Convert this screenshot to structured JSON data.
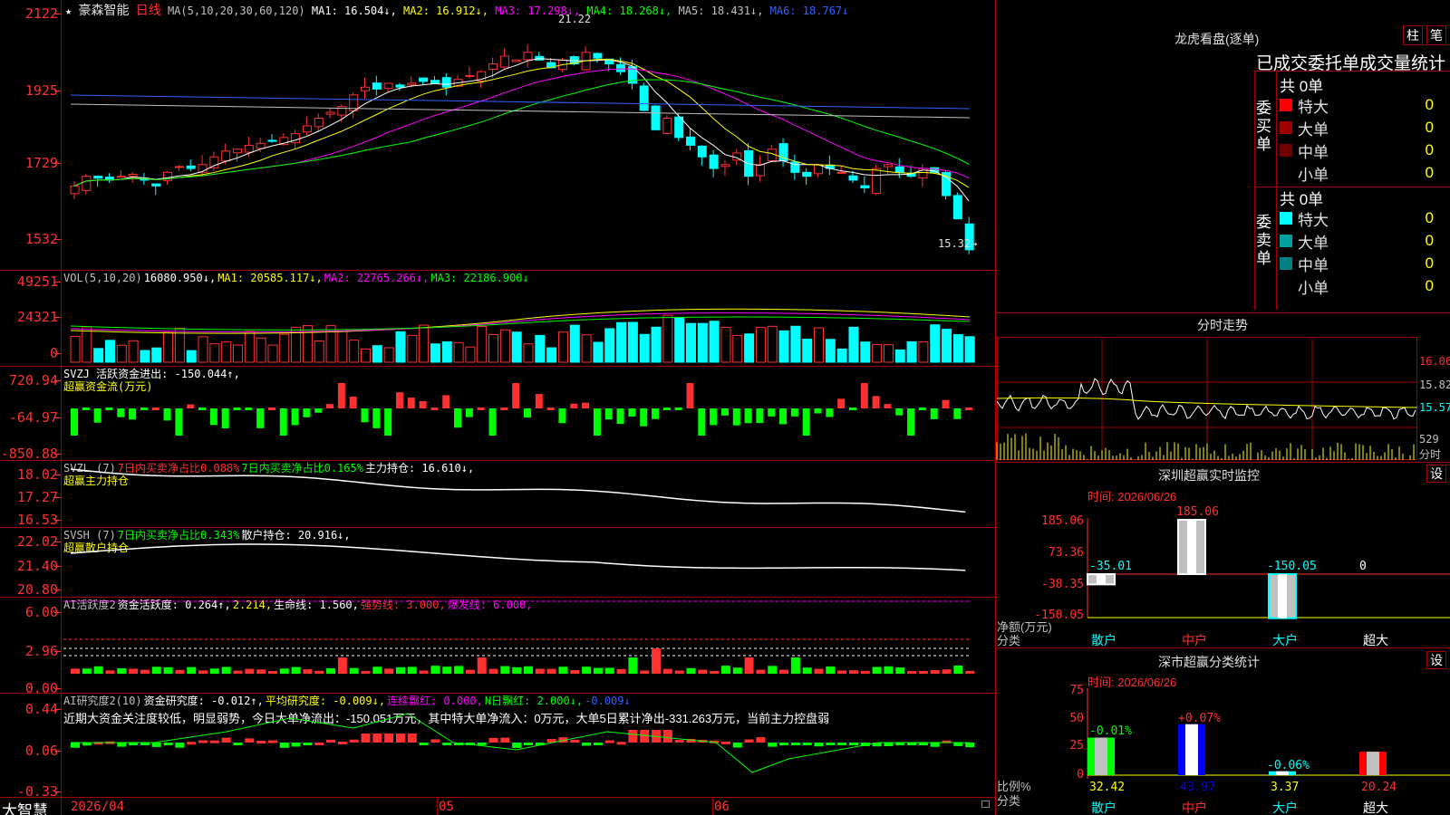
{
  "header": {
    "star": "★",
    "stock_name": "豪森智能",
    "period": "日线",
    "ma_params": "MA(5,10,20,30,60,120)",
    "ma_values": [
      {
        "label": "MA1: 16.504↓,",
        "color": "#ffffff"
      },
      {
        "label": "MA2: 16.912↓,",
        "color": "#ffff00"
      },
      {
        "label": "MA3: 17.298↓,",
        "color": "#ff00ff"
      },
      {
        "label": "MA4: 18.268↓,",
        "color": "#00ff00"
      },
      {
        "label": "MA5: 18.431↓,",
        "color": "#c0c0c0"
      },
      {
        "label": "MA6: 18.767↓",
        "color": "#3060ff"
      }
    ],
    "high_label": "21.22",
    "low_label": "15.32→"
  },
  "price_axis": [
    "2122",
    "1925",
    "1729",
    "1532"
  ],
  "vol_panel": {
    "items": [
      {
        "label": "VOL(5,10,20)",
        "color": "#c0c0c0"
      },
      {
        "label": "16080.950↓,",
        "color": "#ffffff"
      },
      {
        "label": "MA1: 20585.117↓,",
        "color": "#ffff00"
      },
      {
        "label": "MA2: 22765.266↓,",
        "color": "#ff00ff"
      },
      {
        "label": "MA3: 22186.900↓",
        "color": "#00ff00"
      }
    ],
    "axis": [
      "49251",
      "24321",
      "0"
    ]
  },
  "svzj_panel": {
    "items": [
      {
        "label": "SVZJ  活跃资金进出: -150.044↑,",
        "color": "#ffffff"
      }
    ],
    "line2": "超赢资金流(万元)",
    "axis": [
      "720.94",
      "-64.97",
      "-850.88"
    ]
  },
  "svzl_panel": {
    "items": [
      {
        "label": "SVZL (7)",
        "color": "#c0c0c0"
      },
      {
        "label": "7日内买卖净占比0.088%",
        "color": "#ff3030"
      },
      {
        "label": "7日内买卖净占比0.165%",
        "color": "#00ff00"
      },
      {
        "label": "主力持仓: 16.610↓,",
        "color": "#ffffff"
      }
    ],
    "line2": "超赢主力持仓",
    "axis": [
      "18.02",
      "17.27",
      "16.53"
    ]
  },
  "svsh_panel": {
    "items": [
      {
        "label": "SVSH (7)",
        "color": "#c0c0c0"
      },
      {
        "label": "7日内买卖净占比0.343%",
        "color": "#00ff00"
      },
      {
        "label": "散户持仓: 20.916↓,",
        "color": "#ffffff"
      }
    ],
    "line2": "超赢散户持仓",
    "axis": [
      "22.02",
      "21.40",
      "20.80"
    ]
  },
  "ai_activity_panel": {
    "items": [
      {
        "label": "AI活跃度2",
        "color": "#c0c0c0"
      },
      {
        "label": "资金活跃度: 0.264↑,",
        "color": "#ffffff"
      },
      {
        "label": "2.214,",
        "color": "#ffff00"
      },
      {
        "label": "生命线: 1.560,",
        "color": "#ffffff"
      },
      {
        "label": "强势线: 3.000,",
        "color": "#ff3030"
      },
      {
        "label": "爆发线: 6.000,",
        "color": "#ff00ff"
      }
    ],
    "axis": [
      "6.00",
      "2.96",
      "0.00"
    ]
  },
  "ai_research_panel": {
    "items": [
      {
        "label": "AI研究度2(10)",
        "color": "#c0c0c0"
      },
      {
        "label": "资金研究度: -0.012↑,",
        "color": "#ffffff"
      },
      {
        "label": "平均研究度: -0.009↓,",
        "color": "#ffff00"
      },
      {
        "label": "连续飘红: 0.000,",
        "color": "#ff00ff"
      },
      {
        "label": "N日飘红: 2.000↓,",
        "color": "#00ff00"
      },
      {
        "label": "-0.009↓",
        "color": "#3060ff"
      }
    ],
    "note": "近期大资金关注度较低，明显弱势，今日大单净流出：-150.051万元，其中特大单净流入：0万元，大单5日累计净出-331.263万元，当前主力控盘弱",
    "axis": [
      "0.44",
      "0.06",
      "-0.33"
    ]
  },
  "bottom_bar": {
    "brand": "大智慧",
    "dates": [
      "2026/04",
      "05",
      "06"
    ]
  },
  "right_panel": {
    "dragon_title": "龙虎看盘(逐单)",
    "btn_column": "柱",
    "btn_brush": "笔",
    "tabs_line": "已成交委托单成交量统计",
    "buy_side": {
      "side_label": "委买单",
      "total": "共 0单",
      "rows": [
        {
          "label": "特大",
          "count": "0",
          "pct": "0%",
          "color": "#ff0000"
        },
        {
          "label": "大单",
          "count": "0",
          "pct": "0%",
          "color": "#a00000"
        },
        {
          "label": "中单",
          "count": "0",
          "pct": "0%",
          "color": "#700000"
        },
        {
          "label": "小单",
          "count": "0",
          "pct": "0%",
          "color": "#000000"
        }
      ]
    },
    "sell_side": {
      "side_label": "委卖单",
      "total": "共 0单",
      "rows": [
        {
          "label": "特大",
          "count": "0",
          "pct": "0%",
          "color": "#00ffff"
        },
        {
          "label": "大单",
          "count": "0",
          "pct": "0%",
          "color": "#00a0a0"
        },
        {
          "label": "中单",
          "count": "0",
          "pct": "0%",
          "color": "#008080"
        },
        {
          "label": "小单",
          "count": "0",
          "pct": "0%",
          "color": "#000000"
        }
      ]
    },
    "intraday": {
      "title": "分时走势",
      "axis": [
        "16.06",
        "15.82",
        "15.57"
      ],
      "vol_label": "529",
      "vol_unit": "分时"
    },
    "monitor": {
      "title": "深圳超赢实时监控",
      "settings": "设",
      "time": "时间: 2026/06/26",
      "ylabel": "净额(万元)",
      "xlabel": "分类",
      "axis": [
        "185.06",
        "73.36",
        "-38.35",
        "-150.05"
      ],
      "categories": [
        "散户",
        "中户",
        "大户",
        "超大"
      ],
      "values": [
        "-35.01",
        "185.06",
        "-150.05",
        "0"
      ]
    },
    "stats": {
      "title": "深市超赢分类统计",
      "settings": "设",
      "time": "时间: 2026/06/26",
      "ylabel": "比例%",
      "xlabel": "分类",
      "axis": [
        "75",
        "50",
        "25",
        "0"
      ],
      "categories": [
        "散户",
        "中户",
        "大户",
        "超大"
      ],
      "values": [
        "32.42",
        "43.97",
        "3.37",
        "20.24"
      ],
      "changes": [
        "-0.01%",
        "+0.07%",
        "-0.06%",
        ""
      ]
    }
  }
}
